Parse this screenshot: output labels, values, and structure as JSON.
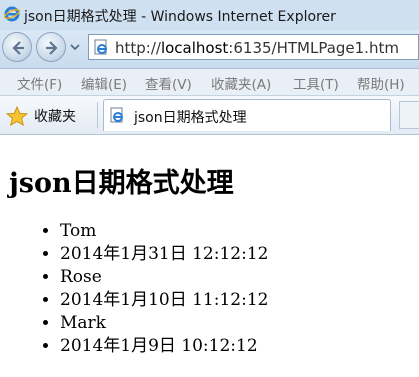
{
  "window": {
    "title": "json日期格式处理 - Windows Internet Explorer"
  },
  "address_bar": {
    "url_prefix": "http://",
    "url_host": "localhost",
    "url_rest": ":6135/HTMLPage1.htm"
  },
  "menu": {
    "items": [
      "文件(F)",
      "编辑(E)",
      "查看(V)",
      "收藏夹(A)",
      "工具(T)",
      "帮助(H)"
    ]
  },
  "favorites": {
    "label": "收藏夹"
  },
  "tab": {
    "label": "json日期格式处理"
  },
  "page": {
    "heading": "json日期格式处理",
    "items": [
      "Tom",
      "2014年1月31日 12:12:12",
      "Rose",
      "2014年1月10日 11:12:12",
      "Mark",
      "2014年1月9日 10:12:12"
    ]
  },
  "colors": {
    "titlebar": "#cfe0f1",
    "menu_text": "#7a7a7a"
  }
}
